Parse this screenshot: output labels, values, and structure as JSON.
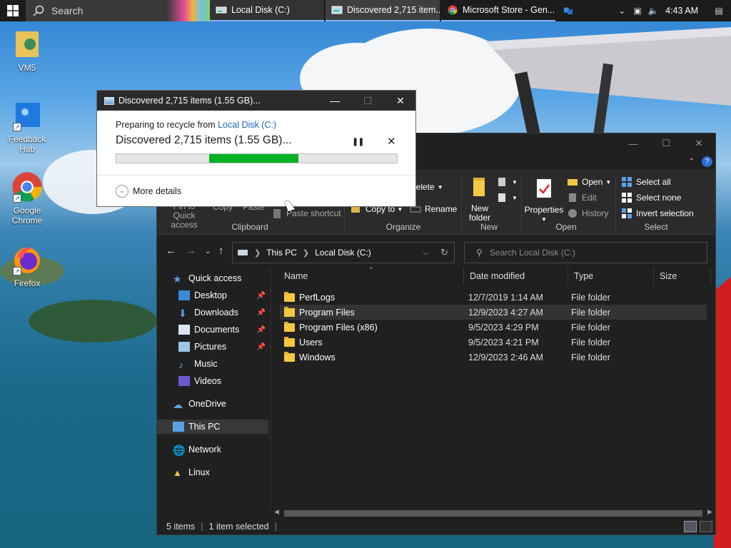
{
  "taskbar": {
    "search_placeholder": "Search",
    "items": [
      {
        "label": "Local Disk (C:)"
      },
      {
        "label": "Discovered 2,715 item..."
      },
      {
        "label": "Microsoft Store - Gen..."
      }
    ],
    "clock": "4:43 AM"
  },
  "desktop": {
    "icons": [
      {
        "label": "VM5"
      },
      {
        "label": "Feedback Hub"
      },
      {
        "label": "Google Chrome"
      },
      {
        "label": "Firefox"
      }
    ]
  },
  "dialog": {
    "title": "Discovered 2,715 items (1.55 GB)...",
    "preparing_prefix": "Preparing to recycle from ",
    "source_link": "Local Disk (C:)",
    "discovered": "Discovered 2,715 items (1.55 GB)...",
    "more_details": "More details",
    "progress": {
      "start_fraction": 0.33,
      "end_fraction": 0.65
    }
  },
  "ribbon": {
    "partial_labels": {
      "pin": "Pin to Quick access",
      "copy": "Copy",
      "paste": "Paste"
    },
    "paste_shortcut": "Paste shortcut",
    "copy_to": "Copy to",
    "delete": "Delete",
    "rename": "Rename",
    "new_folder": "New folder",
    "properties": "Properties",
    "open": "Open",
    "edit": "Edit",
    "history": "History",
    "select_all": "Select all",
    "select_none": "Select none",
    "invert_selection": "Invert selection",
    "groups": {
      "clipboard": "Clipboard",
      "organize": "Organize",
      "new": "New",
      "open": "Open",
      "select": "Select"
    }
  },
  "address": {
    "crumbs": [
      "This PC",
      "Local Disk (C:)"
    ],
    "search_placeholder": "Search Local Disk (C:)"
  },
  "navpane": {
    "quick_access": "Quick access",
    "pinned": [
      "Desktop",
      "Downloads",
      "Documents",
      "Pictures"
    ],
    "unpinned": [
      "Music",
      "Videos"
    ],
    "onedrive": "OneDrive",
    "this_pc": "This PC",
    "network": "Network",
    "linux": "Linux"
  },
  "columns": {
    "name": "Name",
    "date": "Date modified",
    "type": "Type",
    "size": "Size"
  },
  "files": [
    {
      "name": "PerfLogs",
      "date": "12/7/2019 1:14 AM",
      "type": "File folder"
    },
    {
      "name": "Program Files",
      "date": "12/9/2023 4:27 AM",
      "type": "File folder"
    },
    {
      "name": "Program Files (x86)",
      "date": "9/5/2023 4:29 PM",
      "type": "File folder"
    },
    {
      "name": "Users",
      "date": "9/5/2023 4:21 PM",
      "type": "File folder"
    },
    {
      "name": "Windows",
      "date": "12/9/2023 2:46 AM",
      "type": "File folder"
    }
  ],
  "status": {
    "items": "5 items",
    "selected": "1 item selected"
  }
}
